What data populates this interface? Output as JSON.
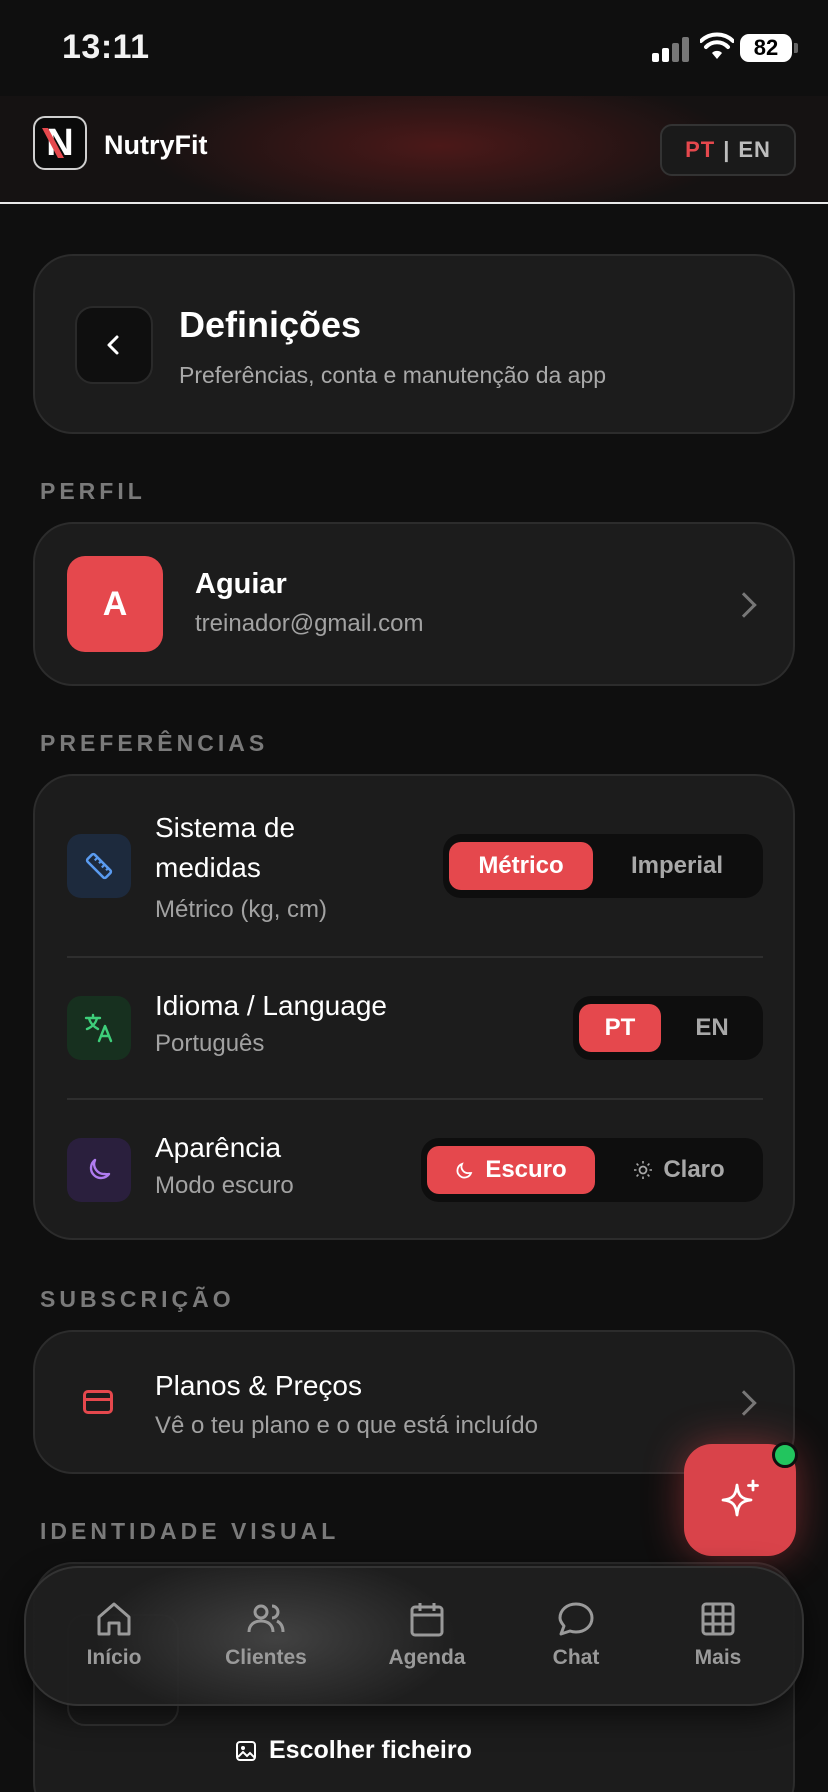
{
  "status_bar": {
    "time": "13:11",
    "battery": "82"
  },
  "header": {
    "brand": "NutryFit",
    "lang_active": "PT",
    "lang_sep": "|",
    "lang_other": "EN"
  },
  "page": {
    "title": "Definições",
    "subtitle": "Preferências, conta e manutenção da app"
  },
  "sections": {
    "profile": "PERFIL",
    "preferences": "PREFERÊNCIAS",
    "subscription": "SUBSCRIÇÃO",
    "visual_identity": "IDENTIDADE VISUAL"
  },
  "profile": {
    "initial": "A",
    "name": "Aguiar",
    "email": "treinador@gmail.com"
  },
  "preferences": {
    "units": {
      "title": "Sistema de medidas",
      "subtitle": "Métrico (kg, cm)",
      "options": [
        "Métrico",
        "Imperial"
      ],
      "selected": "Métrico"
    },
    "language": {
      "title": "Idioma / Language",
      "subtitle": "Português",
      "options": [
        "PT",
        "EN"
      ],
      "selected": "PT"
    },
    "appearance": {
      "title": "Aparência",
      "subtitle": "Modo escuro",
      "options": [
        "Escuro",
        "Claro"
      ],
      "selected": "Escuro"
    }
  },
  "subscription": {
    "title": "Planos & Preços",
    "subtitle": "Vê o teu plano e o que está incluído"
  },
  "visual_identity": {
    "choose_file": "Escolher ficheiro"
  },
  "nav": {
    "items": [
      "Início",
      "Clientes",
      "Agenda",
      "Chat",
      "Mais"
    ]
  },
  "colors": {
    "accent": "#e5484d",
    "background": "#0f0f0f",
    "card": "#1c1c1c",
    "online_dot": "#22c55e"
  }
}
